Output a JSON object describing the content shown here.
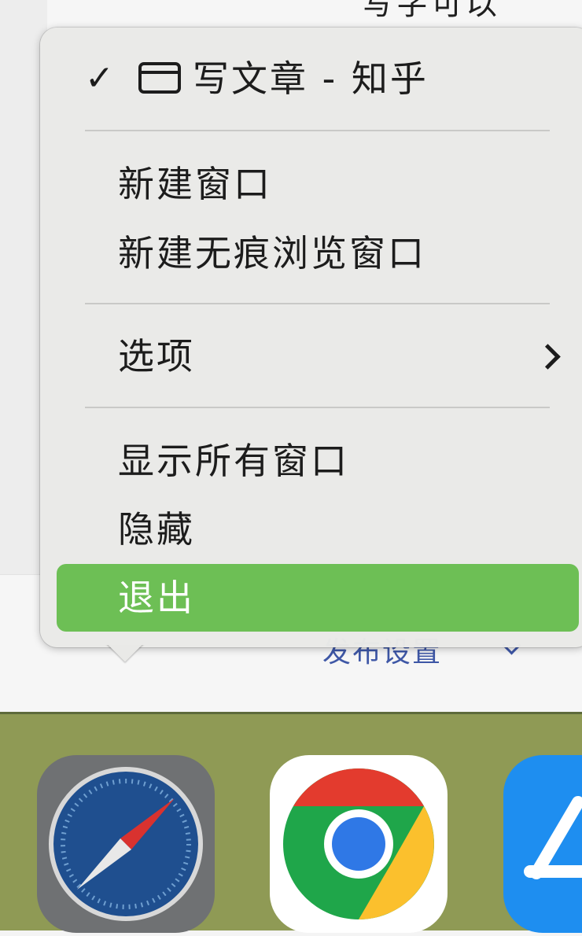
{
  "background": {
    "top_text": "写字可以",
    "publish_label": "发布设置"
  },
  "menu": {
    "current_window": {
      "check": "✓",
      "title": "写文章 - 知乎"
    },
    "new_window": "新建窗口",
    "new_private_window": "新建无痕浏览窗口",
    "options": "选项",
    "show_all_windows": "显示所有窗口",
    "hide": "隐藏",
    "quit": "退出"
  },
  "dock": {
    "apps": [
      "safari-icon",
      "chrome-icon",
      "app-store-icon"
    ]
  },
  "colors": {
    "highlight": "#6dbf55",
    "dock": "#8f9a55"
  }
}
